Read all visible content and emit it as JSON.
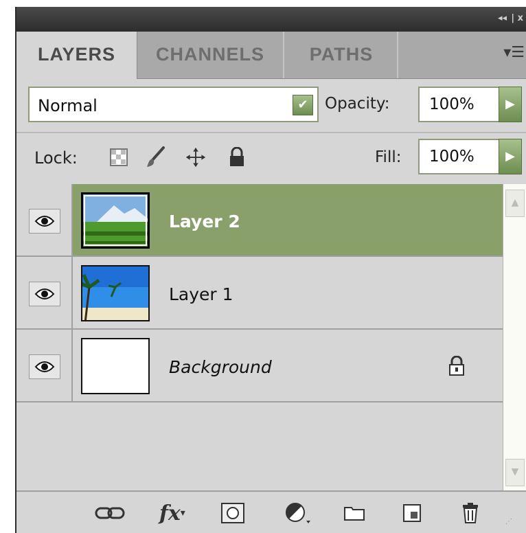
{
  "tabs": [
    {
      "label": "LAYERS",
      "active": true
    },
    {
      "label": "CHANNELS",
      "active": false
    },
    {
      "label": "PATHS",
      "active": false
    }
  ],
  "title_controls": {
    "collapse": "◂◂",
    "close": "| x"
  },
  "panel_menu_icon": "menu-icon",
  "blend": {
    "value": "Normal",
    "opacity_label": "Opacity:",
    "opacity_value": "100%"
  },
  "lock": {
    "label": "Lock:",
    "icons": [
      "lock-transparent-icon",
      "lock-image-icon",
      "lock-position-icon",
      "lock-all-icon"
    ],
    "fill_label": "Fill:",
    "fill_value": "100%"
  },
  "layers": [
    {
      "name": "Layer 2",
      "selected": true,
      "visible": true,
      "thumbnail": "mountain-field-thumbnail",
      "locked": false
    },
    {
      "name": "Layer 1",
      "selected": false,
      "visible": true,
      "thumbnail": "beach-palm-thumbnail",
      "locked": false
    },
    {
      "name": "Background",
      "selected": false,
      "visible": true,
      "thumbnail": "white-thumbnail",
      "locked": true
    }
  ],
  "bottom_toolbar": [
    "link-layers-icon",
    "fx-icon",
    "layer-mask-icon",
    "adjustment-layer-icon",
    "group-folder-icon",
    "new-layer-icon",
    "delete-trash-icon"
  ],
  "colors": {
    "selected_row": "#8aa06a",
    "panel_bg": "#d6d6d6",
    "tab_bar": "#a9a9a9",
    "stepper_green": "#6e8e50"
  }
}
